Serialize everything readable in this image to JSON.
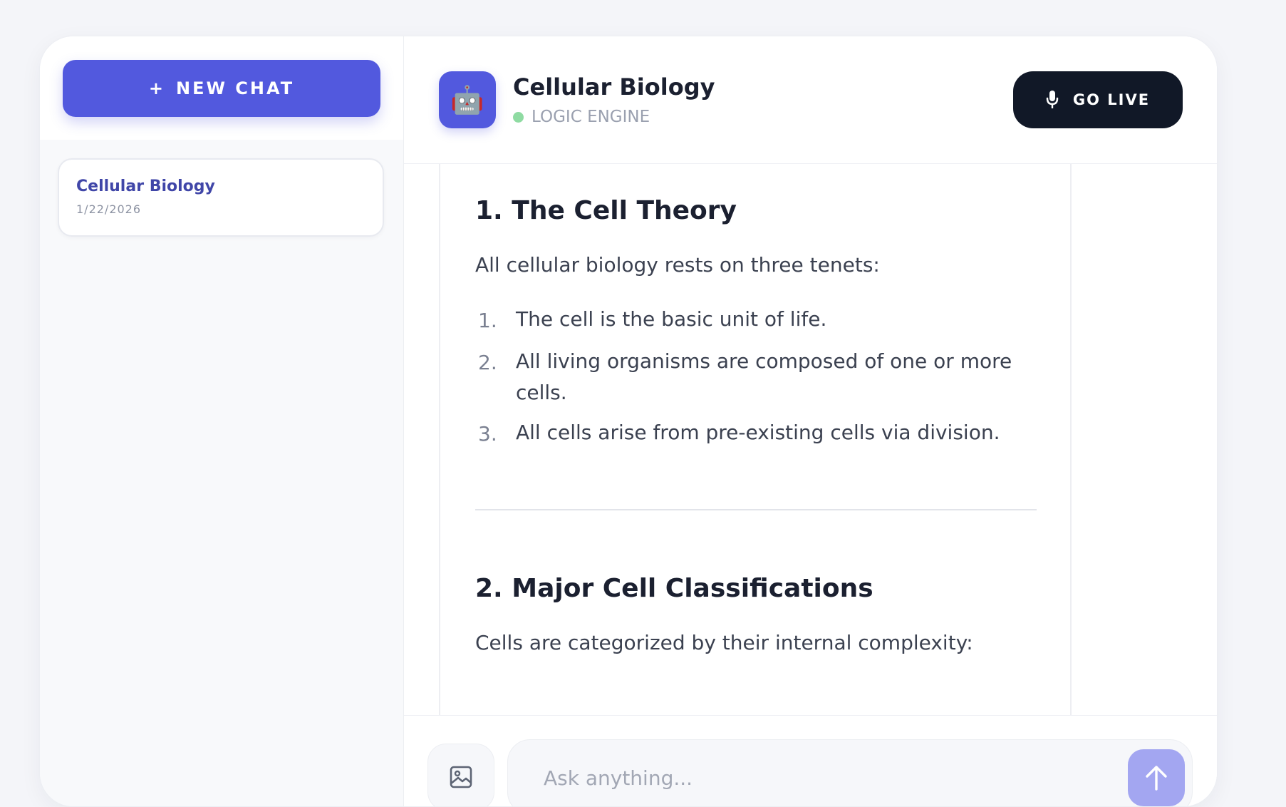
{
  "sidebar": {
    "new_chat_label": "NEW CHAT",
    "new_chat_icon": "+",
    "chats": [
      {
        "title": "Cellular Biology",
        "date": "1/22/2026"
      }
    ]
  },
  "header": {
    "title": "Cellular Biology",
    "status": "LOGIC ENGINE",
    "avatar_icon": "robot-icon",
    "go_live_label": "GO LIVE"
  },
  "message": {
    "section1_heading": "1. The Cell Theory",
    "section1_intro": "All cellular biology rests on three tenets:",
    "tenets": [
      {
        "num": "1.",
        "text": "The cell is the basic unit of life."
      },
      {
        "num": "2.",
        "text": "All living organisms are composed of one or more cells."
      },
      {
        "num": "3.",
        "text": "All cells arise from pre-existing cells via division."
      }
    ],
    "section2_heading": "2. Major Cell Classifications",
    "section2_intro": "Cells are categorized by their internal complexity:"
  },
  "composer": {
    "placeholder": "Ask anything...",
    "value": ""
  },
  "colors": {
    "accent": "#5259de",
    "dark": "#111827",
    "status_dot": "#8fdba2",
    "send_button": "#a3a6f1"
  }
}
